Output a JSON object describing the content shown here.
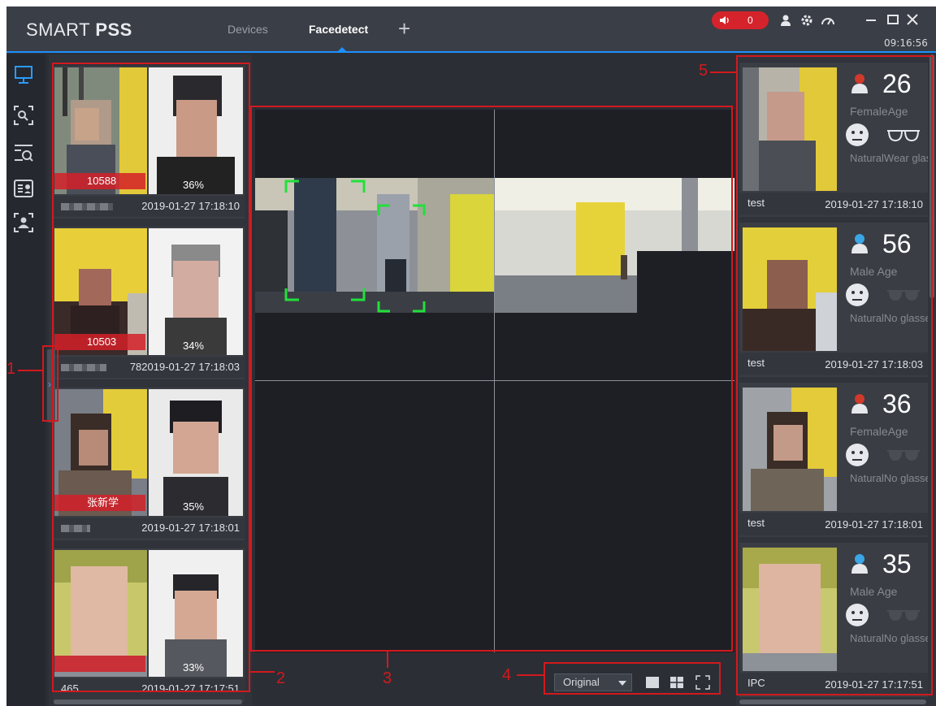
{
  "app": {
    "title_regular": "SMART ",
    "title_bold": "PSS",
    "tabs": [
      {
        "label": "Devices",
        "active": false
      },
      {
        "label": "Facedetect",
        "active": true
      }
    ],
    "alarm_count": "0",
    "clock": "09:16:56"
  },
  "colors": {
    "accent": "#1e90ff",
    "alarm": "#d5232b",
    "annotation": "#d2191e",
    "face_box": "#22e03a"
  },
  "left_nav": [
    "monitor-icon",
    "face-search-icon",
    "search-icon",
    "face-id-icon",
    "face-library-icon"
  ],
  "captures": [
    {
      "id": "10588",
      "similarity": "36%",
      "name": "",
      "time": "2019-01-27 17:18:10"
    },
    {
      "id": "10503",
      "similarity": "34%",
      "name": "78",
      "time": "2019-01-27 17:18:03"
    },
    {
      "id": "张新学",
      "similarity": "35%",
      "name": "",
      "time": "2019-01-27 17:18:01"
    },
    {
      "id": "",
      "similarity": "33%",
      "name": "465",
      "time": "2019-01-27 17:17:51"
    }
  ],
  "video": {
    "ratio_selected": "Original",
    "layout": "2x2"
  },
  "attributes": [
    {
      "gender": "Female",
      "age": "26",
      "age_label": "Age",
      "expression": "Natural",
      "glasses": "Wear glasses",
      "gender_color": "#d03a2a",
      "device": "test",
      "time": "2019-01-27 17:18:10"
    },
    {
      "gender": "Male",
      "age": "56",
      "age_label": "Age",
      "expression": "Natural",
      "glasses": "No glasses",
      "gender_color": "#3aa6e6",
      "device": "test",
      "time": "2019-01-27 17:18:03"
    },
    {
      "gender": "Female",
      "age": "36",
      "age_label": "Age",
      "expression": "Natural",
      "glasses": "No glasses",
      "gender_color": "#d03a2a",
      "device": "test",
      "time": "2019-01-27 17:18:01"
    },
    {
      "gender": "Male",
      "age": "35",
      "age_label": "Age",
      "expression": "Natural",
      "glasses": "No glasses",
      "gender_color": "#3aa6e6",
      "device": "IPC",
      "time": "2019-01-27 17:17:51"
    }
  ],
  "annotations": {
    "c1": "1",
    "c2": "2",
    "c3": "3",
    "c4": "4",
    "c5": "5"
  }
}
